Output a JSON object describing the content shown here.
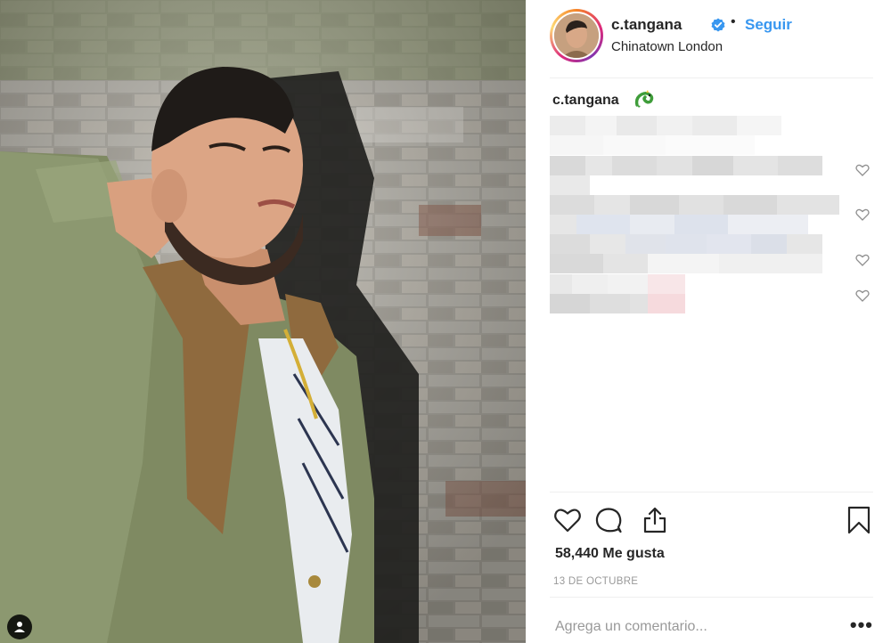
{
  "header": {
    "username": "c.tangana",
    "separator": "•",
    "follow_label": "Seguir",
    "location": "Chinatown London"
  },
  "caption": {
    "username": "c.tangana",
    "emoji": "dragon-emoji"
  },
  "post": {
    "likes_text": "58,440 Me gusta",
    "date": "13 DE OCTUBRE"
  },
  "comment": {
    "placeholder": "Agrega un comentario...",
    "more_label": "•••"
  },
  "colors": {
    "follow": "#3897f0",
    "verified": "#3897f0",
    "text": "#262626",
    "muted": "#999999",
    "divider": "#efefef"
  },
  "icons": [
    "user-tag-icon",
    "verified-badge-icon",
    "heart-icon",
    "comment-icon",
    "share-icon",
    "bookmark-icon",
    "small-heart-icon"
  ]
}
